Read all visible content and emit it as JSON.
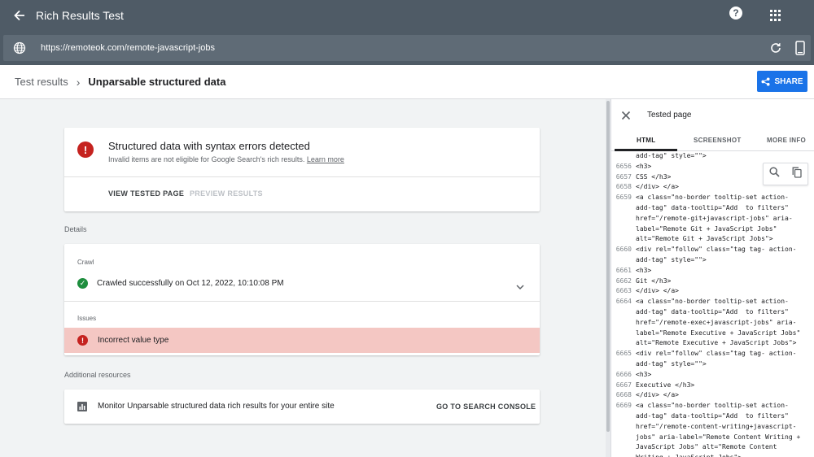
{
  "app": {
    "title": "Rich Results Test"
  },
  "url_bar": {
    "url": "https://remoteok.com/remote-javascript-jobs"
  },
  "breadcrumb": {
    "parent": "Test results",
    "current": "Unparsable structured data"
  },
  "share_button": {
    "label": "SHARE"
  },
  "error_card": {
    "title": "Structured data with syntax errors detected",
    "subtitle": "Invalid items are not eligible for Google Search's rich results.",
    "learn_more": "Learn more",
    "view_tested_page": "VIEW TESTED PAGE",
    "preview_results": "PREVIEW RESULTS"
  },
  "details": {
    "section_label": "Details",
    "crawl_label": "Crawl",
    "crawl_status": "Crawled successfully on Oct 12, 2022, 10:10:08 PM",
    "issues_label": "Issues",
    "issue_text": "Incorrect value type"
  },
  "additional": {
    "section_label": "Additional resources",
    "monitor_text": "Monitor Unparsable structured data rich results for your entire site",
    "console_link": "GO TO SEARCH CONSOLE"
  },
  "tested_page": {
    "title": "Tested page",
    "tabs": [
      "HTML",
      "SCREENSHOT",
      "MORE INFO"
    ],
    "active_tab": "HTML",
    "code_lines": [
      {
        "n": "",
        "t": "add-tag\" style=\"\">"
      },
      {
        "n": "6656",
        "t": "<h3>"
      },
      {
        "n": "6657",
        "t": "CSS </h3>"
      },
      {
        "n": "6658",
        "t": "</div> </a>"
      },
      {
        "n": "6659",
        "t": "<a class=\"no-border tooltip-set action-"
      },
      {
        "n": "",
        "t": "add-tag\" data-tooltip=\"Add  to filters\""
      },
      {
        "n": "",
        "t": "href=\"/remote-git+javascript-jobs\" aria-"
      },
      {
        "n": "",
        "t": "label=\"Remote Git + JavaScript Jobs\""
      },
      {
        "n": "",
        "t": "alt=\"Remote Git + JavaScript Jobs\">"
      },
      {
        "n": "6660",
        "t": "<div rel=\"follow\" class=\"tag tag- action-"
      },
      {
        "n": "",
        "t": "add-tag\" style=\"\">"
      },
      {
        "n": "6661",
        "t": "<h3>"
      },
      {
        "n": "6662",
        "t": "Git </h3>"
      },
      {
        "n": "6663",
        "t": "</div> </a>"
      },
      {
        "n": "6664",
        "t": "<a class=\"no-border tooltip-set action-"
      },
      {
        "n": "",
        "t": "add-tag\" data-tooltip=\"Add  to filters\""
      },
      {
        "n": "",
        "t": "href=\"/remote-exec+javascript-jobs\" aria-"
      },
      {
        "n": "",
        "t": "label=\"Remote Executive + JavaScript Jobs\""
      },
      {
        "n": "",
        "t": "alt=\"Remote Executive + JavaScript Jobs\">"
      },
      {
        "n": "6665",
        "t": "<div rel=\"follow\" class=\"tag tag- action-"
      },
      {
        "n": "",
        "t": "add-tag\" style=\"\">"
      },
      {
        "n": "6666",
        "t": "<h3>"
      },
      {
        "n": "6667",
        "t": "Executive </h3>"
      },
      {
        "n": "6668",
        "t": "</div> </a>"
      },
      {
        "n": "6669",
        "t": "<a class=\"no-border tooltip-set action-"
      },
      {
        "n": "",
        "t": "add-tag\" data-tooltip=\"Add  to filters\""
      },
      {
        "n": "",
        "t": "href=\"/remote-content-writing+javascript-"
      },
      {
        "n": "",
        "t": "jobs\" aria-label=\"Remote Content Writing +"
      },
      {
        "n": "",
        "t": "JavaScript Jobs\" alt=\"Remote Content"
      },
      {
        "n": "",
        "t": "Writing + JavaScript Jobs\">"
      }
    ]
  },
  "icons": {
    "back": "arrow-back-icon",
    "help": "help-icon",
    "apps": "apps-grid-icon",
    "globe": "globe-icon",
    "refresh": "refresh-icon",
    "device": "smartphone-icon",
    "share": "share-icon",
    "error": "error-icon",
    "ok": "check-circle-icon",
    "chevron": "chevron-down-icon",
    "chart": "bar-chart-icon",
    "close": "close-icon",
    "search": "search-icon",
    "copy": "copy-icon"
  },
  "colors": {
    "topbar": "#4f5b66",
    "accent": "#1a73e8",
    "error": "#c5221f",
    "success": "#1e8e3e",
    "issue_bg": "#f4c7c3"
  }
}
